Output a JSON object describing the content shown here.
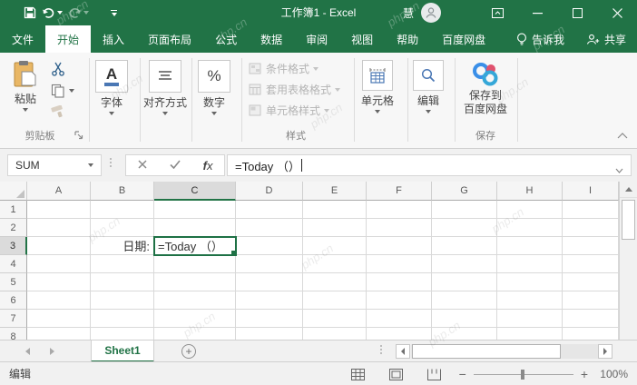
{
  "watermark": {
    "text": "php.cn"
  },
  "title_bar": {
    "title": "工作簿1 - Excel",
    "user_name": "慧"
  },
  "ribbon_tabs": [
    {
      "label": "文件"
    },
    {
      "label": "开始"
    },
    {
      "label": "插入"
    },
    {
      "label": "页面布局"
    },
    {
      "label": "公式"
    },
    {
      "label": "数据"
    },
    {
      "label": "审阅"
    },
    {
      "label": "视图"
    },
    {
      "label": "帮助"
    },
    {
      "label": "百度网盘"
    }
  ],
  "tell_me": {
    "label": "告诉我"
  },
  "share": {
    "label": "共享"
  },
  "ribbon": {
    "paste_label": "粘贴",
    "clipboard_group_label": "剪贴板",
    "font_label": "字体",
    "alignment_label": "对齐方式",
    "number_label": "数字",
    "conditional_formatting_label": "条件格式",
    "format_as_table_label": "套用表格格式",
    "cell_styles_label": "单元格样式",
    "styles_group_label": "样式",
    "cells_label": "单元格",
    "editing_label": "编辑",
    "baidu_save_line1": "保存到",
    "baidu_save_line2": "百度网盘",
    "save_group_label": "保存"
  },
  "formula_bar": {
    "name_box_value": "SUM",
    "formula_value": "=Today （）"
  },
  "grid": {
    "column_headers": [
      "A",
      "B",
      "C",
      "D",
      "E",
      "F",
      "G",
      "H",
      "I"
    ],
    "row_headers": [
      "1",
      "2",
      "3",
      "4",
      "5",
      "6",
      "7",
      "8"
    ],
    "active_cell": "C3",
    "cells": [
      {
        "ref": "B3",
        "text": "日期:",
        "align": "right"
      },
      {
        "ref": "C3",
        "text": "=Today （）",
        "align": "left"
      }
    ]
  },
  "sheet_bar": {
    "sheet_tabs": [
      {
        "label": "Sheet1",
        "active": true
      }
    ]
  },
  "status_bar": {
    "mode": "编辑",
    "zoom_level": "100%"
  },
  "colors": {
    "chrome_green": "#217346",
    "selection_green": "#1e7145",
    "baidu_blue": "#3a8fe8",
    "baidu_red": "#e0526e",
    "baidu_teal": "#2ab5c8"
  }
}
